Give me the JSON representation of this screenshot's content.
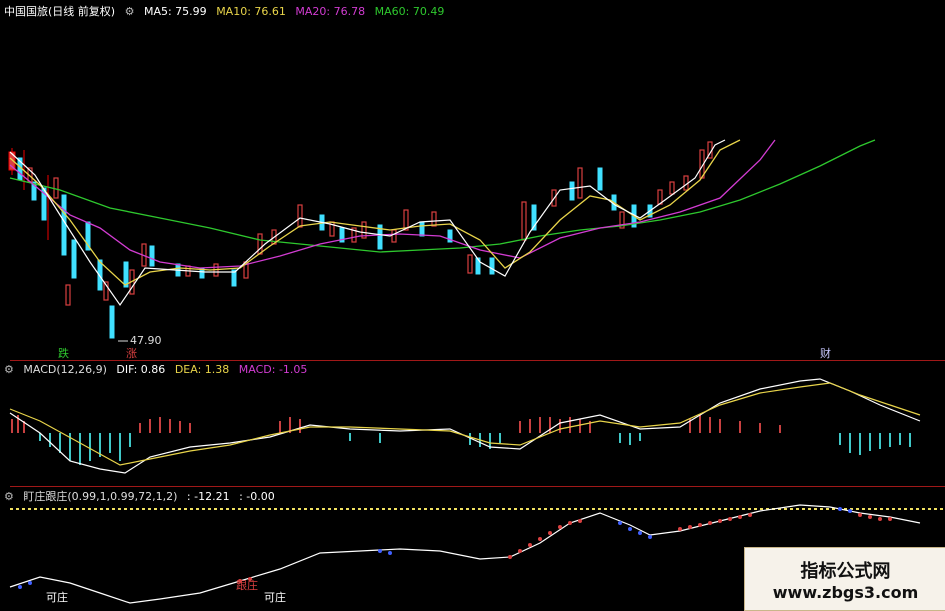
{
  "main": {
    "title": "中国国旅(日线 前复权)",
    "ma5": "MA5: 75.99",
    "ma10": "MA10: 76.61",
    "ma20": "MA20: 76.78",
    "ma60": "MA60: 70.49",
    "low_price": "47.90",
    "mark_die": "跌",
    "mark_zhang": "涨",
    "mark_cai": "财"
  },
  "macd": {
    "name": "MACD(12,26,9)",
    "dif": "DIF: 0.86",
    "dea": "DEA: 1.38",
    "macd": "MACD: -1.05"
  },
  "zhuang": {
    "name": "盯庄跟庄(0.99,1,0.99,72,1,2)",
    "v1": ": -12.21",
    "v2": ": -0.00",
    "label1": "可庄",
    "label2": "可庄",
    "label3": "跟庄"
  },
  "watermark": {
    "title": "指标公式网",
    "url": "www.zbgs3.com"
  },
  "colors": {
    "ma5": "#ffffff",
    "ma10": "#e8d44a",
    "ma20": "#d23cd2",
    "ma60": "#2ec82e",
    "up": "#d94040",
    "down": "#40e0ff",
    "separator": "#a01818"
  },
  "icons": [
    "settings-gear-icon",
    "settings-gear-icon",
    "settings-gear-icon"
  ]
}
